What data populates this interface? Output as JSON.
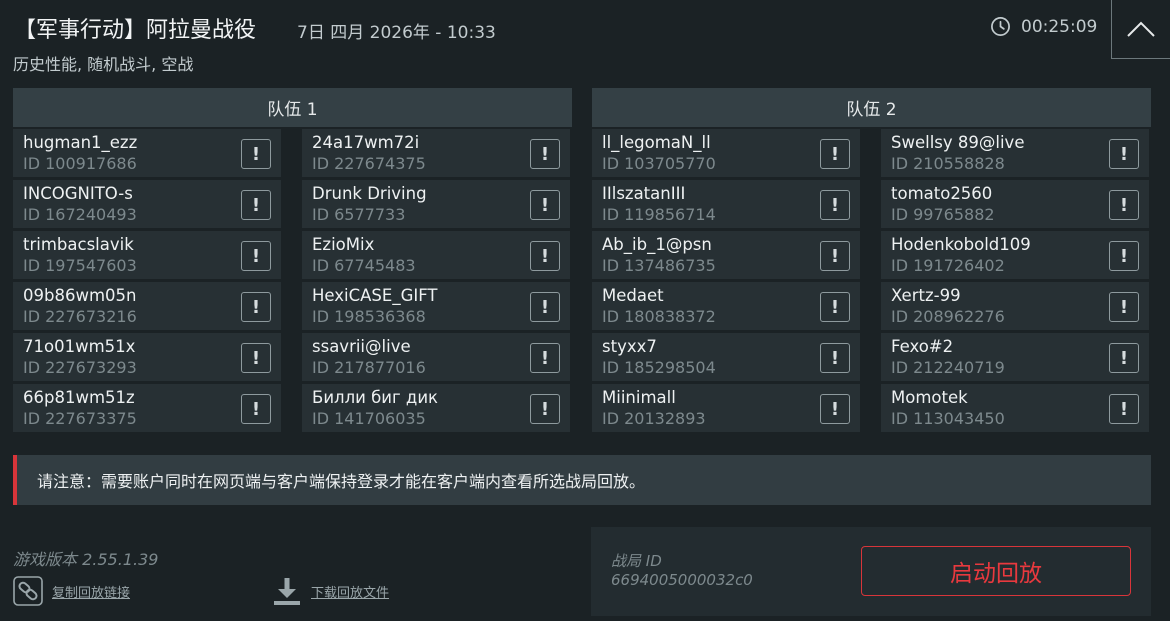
{
  "header": {
    "title": "【军事行动】阿拉曼战役",
    "datetime": "7日 四月 2026年 - 10:33",
    "subtitle": "历史性能, 随机战斗, 空战",
    "timer": "00:25:09"
  },
  "teams": [
    {
      "label": "队伍 1",
      "players": [
        {
          "name": "hugman1_ezz",
          "id": "ID 100917686"
        },
        {
          "name": "INCOGNITO-s",
          "id": "ID 167240493"
        },
        {
          "name": "trimbacslavik",
          "id": "ID 197547603"
        },
        {
          "name": "09b86wm05n",
          "id": "ID 227673216"
        },
        {
          "name": "71o01wm51x",
          "id": "ID 227673293"
        },
        {
          "name": "66p81wm51z",
          "id": "ID 227673375"
        },
        {
          "name": "24a17wm72i",
          "id": "ID 227674375"
        },
        {
          "name": "Drunk Driving",
          "id": "ID 6577733"
        },
        {
          "name": "EzioMix",
          "id": "ID 67745483"
        },
        {
          "name": "HexiCASE_GIFT",
          "id": "ID 198536368"
        },
        {
          "name": "ssavrii@live",
          "id": "ID 217877016"
        },
        {
          "name": "Билли биг дик",
          "id": "ID 141706035"
        }
      ]
    },
    {
      "label": "队伍 2",
      "players": [
        {
          "name": "ll_legomaN_ll",
          "id": "ID 103705770"
        },
        {
          "name": "IIlszatanIII",
          "id": "ID 119856714"
        },
        {
          "name": "Ab_ib_1@psn",
          "id": "ID 137486735"
        },
        {
          "name": "Medaet",
          "id": "ID 180838372"
        },
        {
          "name": "styxx7",
          "id": "ID 185298504"
        },
        {
          "name": "Miinimall",
          "id": "ID 20132893"
        },
        {
          "name": "Swellsy 89@live",
          "id": "ID 210558828"
        },
        {
          "name": "tomato2560",
          "id": "ID 99765882"
        },
        {
          "name": "Hodenkobold109",
          "id": "ID 191726402"
        },
        {
          "name": "Xertz-99",
          "id": "ID 208962276"
        },
        {
          "name": "Fexo#2",
          "id": "ID 212240719"
        },
        {
          "name": "Momotek",
          "id": "ID 113043450"
        }
      ]
    }
  ],
  "report_glyph": "!",
  "notice": "请注意：需要账户同时在网页端与客户端保持登录才能在客户端内查看所选战局回放。",
  "footer": {
    "version": "游戏版本 2.55.1.39",
    "copy_link": "复制回放链接",
    "download": "下载回放文件",
    "battle_id_label": "战局 ID",
    "battle_id": "6694005000032c0",
    "launch": "启动回放"
  },
  "colors": {
    "background": "#1b2225",
    "accent_red": "#d8353a",
    "card": "#273034",
    "header": "#344045"
  }
}
